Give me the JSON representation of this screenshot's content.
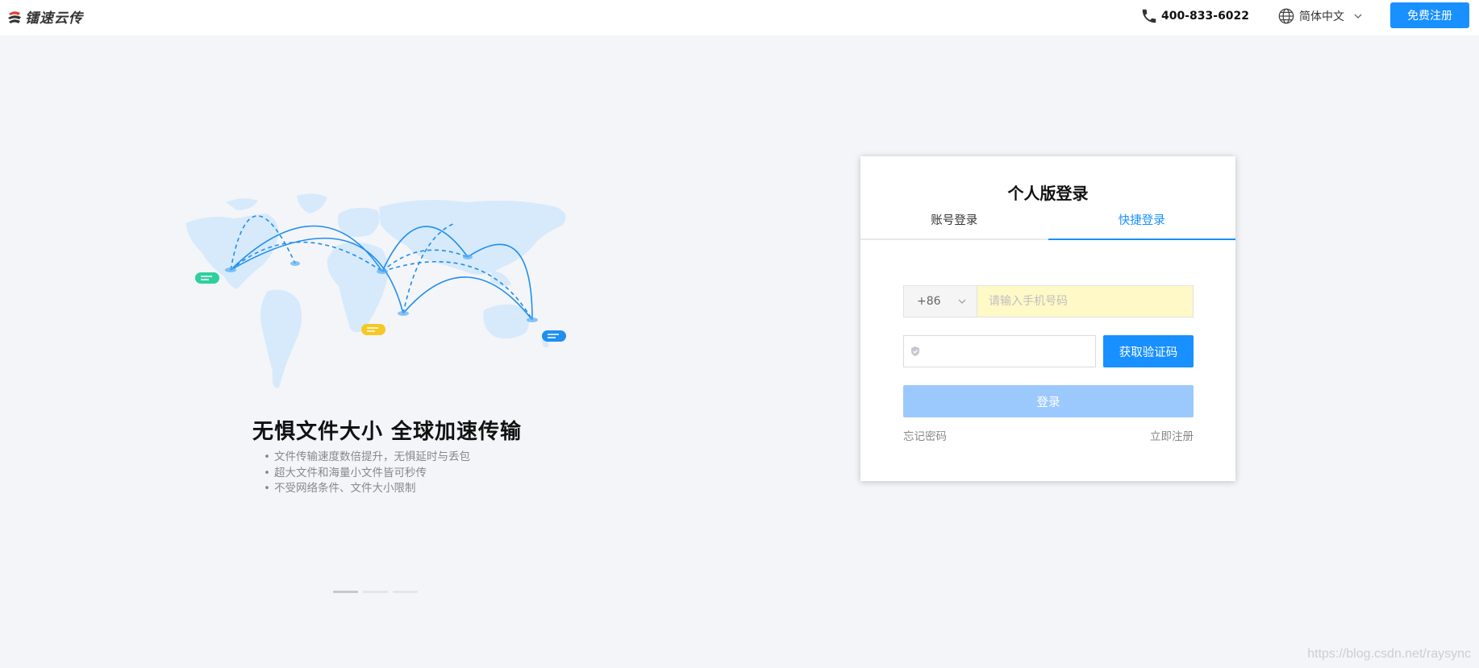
{
  "header": {
    "logo_text": "镭速云传",
    "phone_icon": "phone-icon",
    "phone": "400-833-6022",
    "lang_icon": "globe-icon",
    "language": "简体中文",
    "register_label": "免费注册"
  },
  "hero": {
    "title": "无惧文件大小 全球加速传输",
    "features": [
      "文件传输速度数倍提升，无惧延时与丢包",
      "超大文件和海量小文件皆可秒传",
      "不受网络条件、文件大小限制"
    ],
    "slides": 3,
    "active_slide": 0
  },
  "login": {
    "title": "个人版登录",
    "tabs": [
      {
        "label": "账号登录",
        "active": false
      },
      {
        "label": "快捷登录",
        "active": true
      }
    ],
    "country_code": "+86",
    "phone_placeholder": "请输入手机号码",
    "code_icon": "shield-icon",
    "get_code_label": "获取验证码",
    "login_label": "登录",
    "forgot_label": "忘记密码",
    "signup_label": "立即注册"
  },
  "colors": {
    "accent": "#1890ff",
    "login_disabled": "#9cc9fd",
    "phone_autofill": "#fff8c7",
    "background": "#f4f5f9"
  },
  "watermark": "https://blog.csdn.net/raysync"
}
